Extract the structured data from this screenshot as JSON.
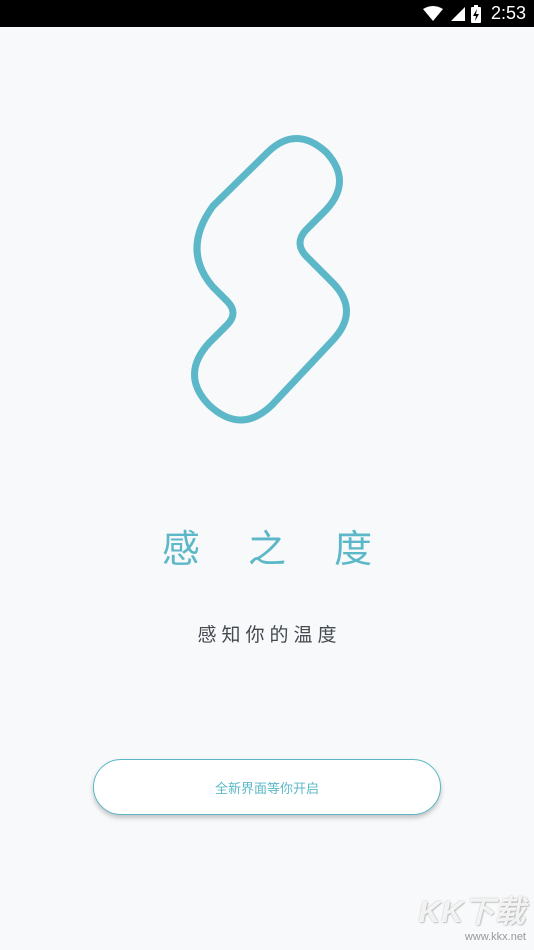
{
  "status_bar": {
    "time": "2:53",
    "icons": [
      "wifi-icon",
      "cell-signal-icon",
      "battery-charging-icon"
    ]
  },
  "logo": {
    "icon": "s-loop-logo-icon",
    "color": "#5cb8c8"
  },
  "app_name": "感 之 度",
  "tagline": "感知你的温度",
  "start_button": {
    "label": "全新界面等你开启"
  },
  "watermark": {
    "logo_text": "KK下载",
    "url": "www.kkx.net"
  },
  "colors": {
    "accent": "#5cb8c8",
    "background": "#f8f9fa",
    "text": "#444a50"
  }
}
